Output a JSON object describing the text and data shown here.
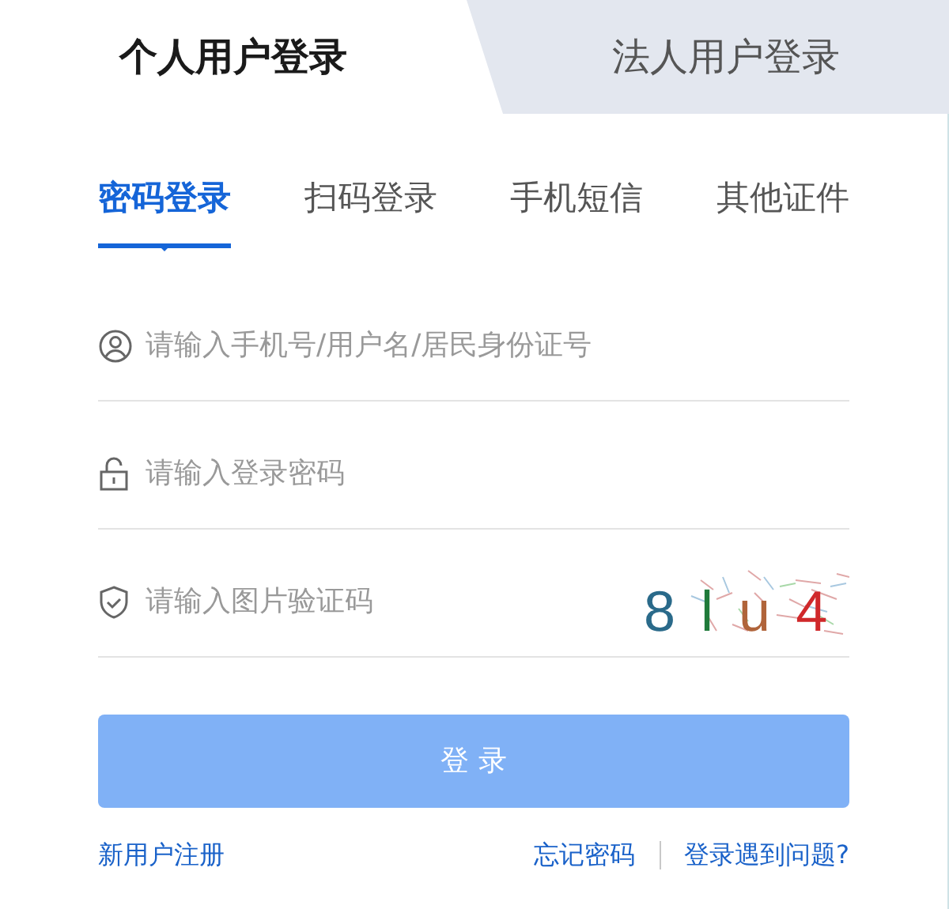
{
  "user_tabs": [
    {
      "label": "个人用户登录",
      "selected": true
    },
    {
      "label": "法人用户登录",
      "selected": false
    }
  ],
  "method_tabs": [
    {
      "label": "密码登录",
      "selected": true
    },
    {
      "label": "扫码登录",
      "selected": false
    },
    {
      "label": "手机短信",
      "selected": false
    },
    {
      "label": "其他证件",
      "selected": false
    }
  ],
  "fields": [
    {
      "kind": "user",
      "placeholder": "请输入手机号/用户名/居民身份证号"
    },
    {
      "kind": "password",
      "placeholder": "请输入登录密码"
    },
    {
      "kind": "captcha",
      "placeholder": "请输入图片验证码",
      "captcha": [
        {
          "char": "8",
          "color": "#2a6a8a"
        },
        {
          "char": "l",
          "color": "#1f7a3a"
        },
        {
          "char": "u",
          "color": "#b0643a"
        },
        {
          "char": "4",
          "color": "#d0282a"
        }
      ]
    }
  ],
  "login_button": "登 录",
  "links": {
    "register": "新用户注册",
    "forgot": "忘记密码",
    "help": "登录遇到问题?"
  }
}
